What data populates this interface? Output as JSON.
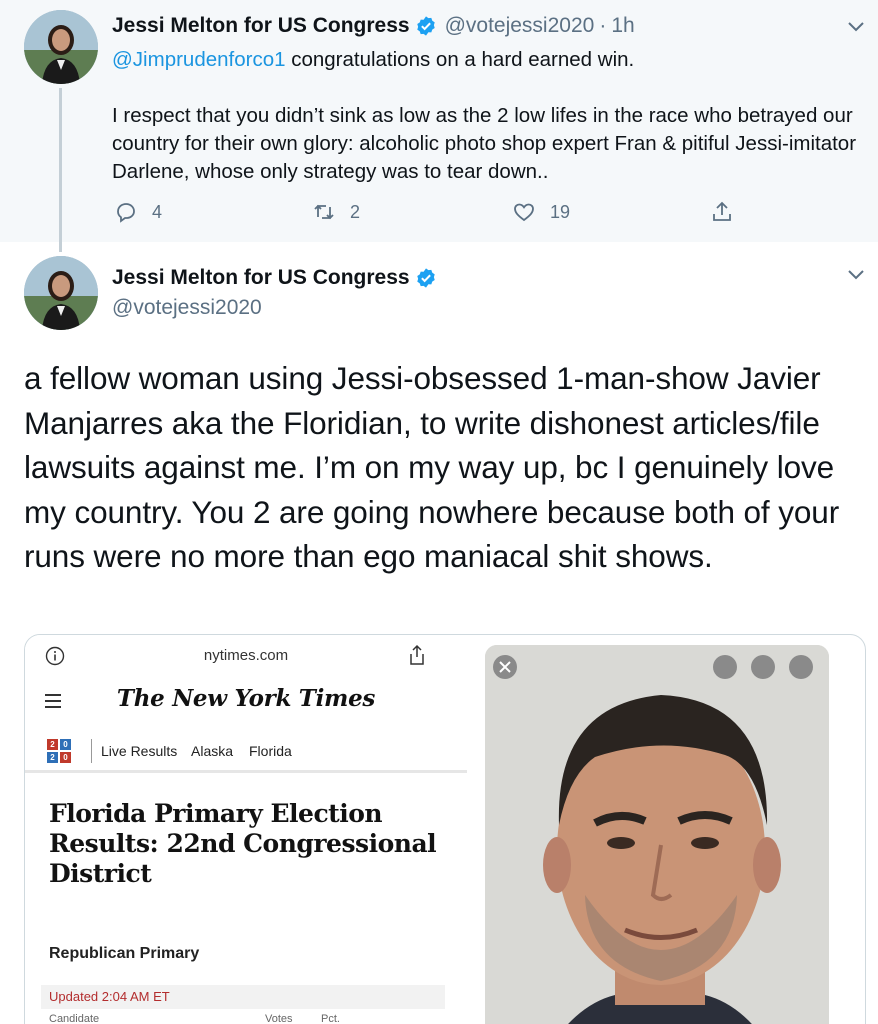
{
  "tweet1": {
    "author_name": "Jessi Melton for US Congress",
    "handle": "@votejessi2020",
    "separator": "·",
    "time": "1h",
    "mention": "@Jimprudenforco1",
    "line1_rest": " congratulations on a hard earned win.",
    "paragraph2": "I respect that you didn’t sink as low as the 2 low lifes in the race who betrayed our country for their own glory: alcoholic photo shop expert Fran & pitiful Jessi-imitator Darlene, whose only strategy was to tear down..",
    "reply_count": "4",
    "retweet_count": "2",
    "like_count": "19"
  },
  "tweet2": {
    "author_name": "Jessi Melton for US Congress",
    "handle": "@votejessi2020",
    "text": "a fellow woman using Jessi-obsessed 1-man-show Javier Manjarres aka the Floridian, to write dishonest articles/file lawsuits against me.  I’m on my way up, bc I genuinely love my country. You 2 are going nowhere because both of your runs were no more than ego maniacal shit shows."
  },
  "media_screenshot": {
    "url": "nytimes.com",
    "logo": "The New York Times",
    "badge_digits": [
      "2",
      "0",
      "2",
      "0"
    ],
    "nav_items": [
      "Live Results",
      "Alaska",
      "Florida"
    ],
    "headline": "Florida Primary Election Results: 22nd Congressional District",
    "section": "Republican Primary",
    "updated": "Updated 2:04 AM ET",
    "columns": [
      "Candidate",
      "Votes",
      "Pct."
    ]
  },
  "colors": {
    "link": "#1b95e0",
    "verified": "#1da1f2",
    "muted": "#5b7083",
    "reply_bg": "#f5f8fa",
    "nyt_updated": "#b32d2e"
  },
  "icons": [
    "verified-badge-icon",
    "chevron-down-icon",
    "reply-icon",
    "retweet-icon",
    "like-icon",
    "share-icon",
    "info-icon",
    "hamburger-icon"
  ]
}
